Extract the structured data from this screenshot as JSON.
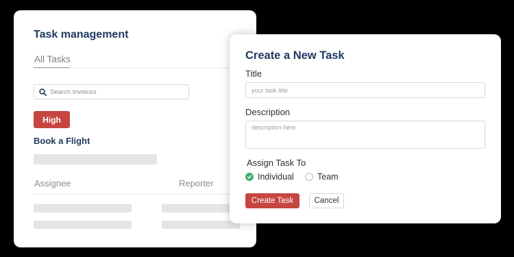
{
  "task_panel": {
    "title": "Task management",
    "tabs": [
      {
        "label": "All Tasks",
        "active": true
      }
    ],
    "search": {
      "placeholder": "Search Invoices",
      "value": "",
      "icon": "search-icon"
    },
    "priority_badge": {
      "label": "High",
      "color": "#c64640"
    },
    "task_name": "Book a Flight",
    "columns": [
      "Assignee",
      "Reporter"
    ]
  },
  "new_task_dialog": {
    "title": "Create a New Task",
    "title_field": {
      "label": "Title",
      "placeholder": "your task title",
      "value": ""
    },
    "description_field": {
      "label": "Description",
      "placeholder": "description here",
      "value": ""
    },
    "assign": {
      "label": "Assign Task To",
      "options": [
        {
          "label": "Individual",
          "selected": true
        },
        {
          "label": "Team",
          "selected": false
        }
      ]
    },
    "buttons": {
      "create": "Create Task",
      "cancel": "Cancel"
    }
  },
  "colors": {
    "accent": "#c64640",
    "heading": "#1f3a60",
    "checked": "#3fae6e"
  }
}
